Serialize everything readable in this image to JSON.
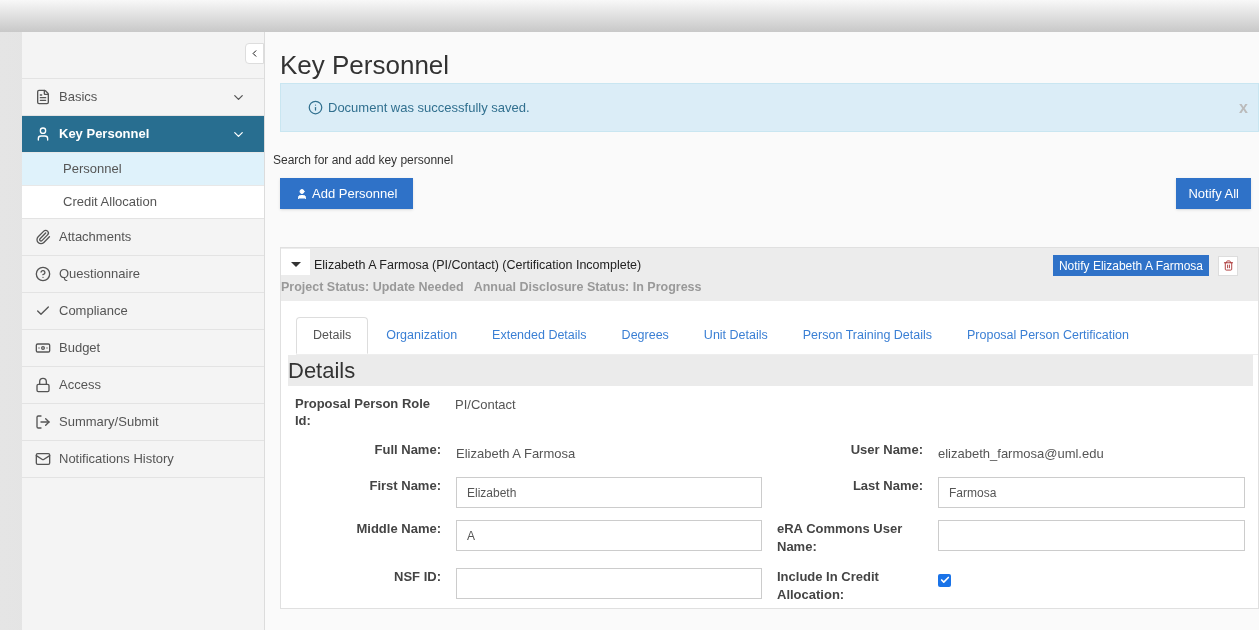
{
  "sidebar": {
    "items": [
      {
        "label": "Basics",
        "selected": false,
        "expandable": true
      },
      {
        "label": "Key Personnel",
        "selected": true,
        "expandable": true,
        "expanded": true,
        "children": [
          {
            "label": "Personnel",
            "selected": true
          },
          {
            "label": "Credit Allocation",
            "selected": false
          }
        ]
      },
      {
        "label": "Attachments",
        "selected": false
      },
      {
        "label": "Questionnaire",
        "selected": false
      },
      {
        "label": "Compliance",
        "selected": false
      },
      {
        "label": "Budget",
        "selected": false
      },
      {
        "label": "Access",
        "selected": false
      },
      {
        "label": "Summary/Submit",
        "selected": false
      },
      {
        "label": "Notifications History",
        "selected": false
      }
    ]
  },
  "page": {
    "title": "Key Personnel",
    "alert": {
      "message": "Document was successfully saved.",
      "close": "x"
    },
    "search_hint": "Search for and add key personnel",
    "add_button": "Add Personnel",
    "notify_all_button": "Notify All"
  },
  "person": {
    "expanded": true,
    "name": "Elizabeth A Farmosa (PI/Contact) (Certification Incomplete)",
    "project_status": "Project Status: Update Needed",
    "disclosure_status": "Annual Disclosure Status: In Progress",
    "notify_button": "Notify Elizabeth A Farmosa",
    "tabs": [
      {
        "label": "Details",
        "selected": true
      },
      {
        "label": "Organization",
        "selected": false
      },
      {
        "label": "Extended Details",
        "selected": false
      },
      {
        "label": "Degrees",
        "selected": false
      },
      {
        "label": "Unit Details",
        "selected": false
      },
      {
        "label": "Person Training Details",
        "selected": false
      },
      {
        "label": "Proposal Person Certification",
        "selected": false
      }
    ],
    "section_title": "Details",
    "role": {
      "label": "Proposal Person Role Id:",
      "value": "PI/Contact"
    },
    "fields": [
      {
        "kind": "text",
        "label": "Full Name:",
        "value": "Elizabeth A Farmosa"
      },
      {
        "kind": "text",
        "label": "User Name:",
        "value": "elizabeth_farmosa@uml.edu"
      },
      {
        "kind": "input",
        "label": "First Name:",
        "value": "Elizabeth"
      },
      {
        "kind": "input",
        "label": "Last Name:",
        "value": "Farmosa"
      },
      {
        "kind": "input",
        "label": "Middle Name:",
        "value": "A"
      },
      {
        "kind": "input",
        "label": "eRA Commons User Name:"
      },
      {
        "kind": "input",
        "label": "NSF ID:"
      },
      {
        "kind": "checkbox",
        "label": "Include In Credit Allocation:",
        "checked": true
      }
    ]
  }
}
